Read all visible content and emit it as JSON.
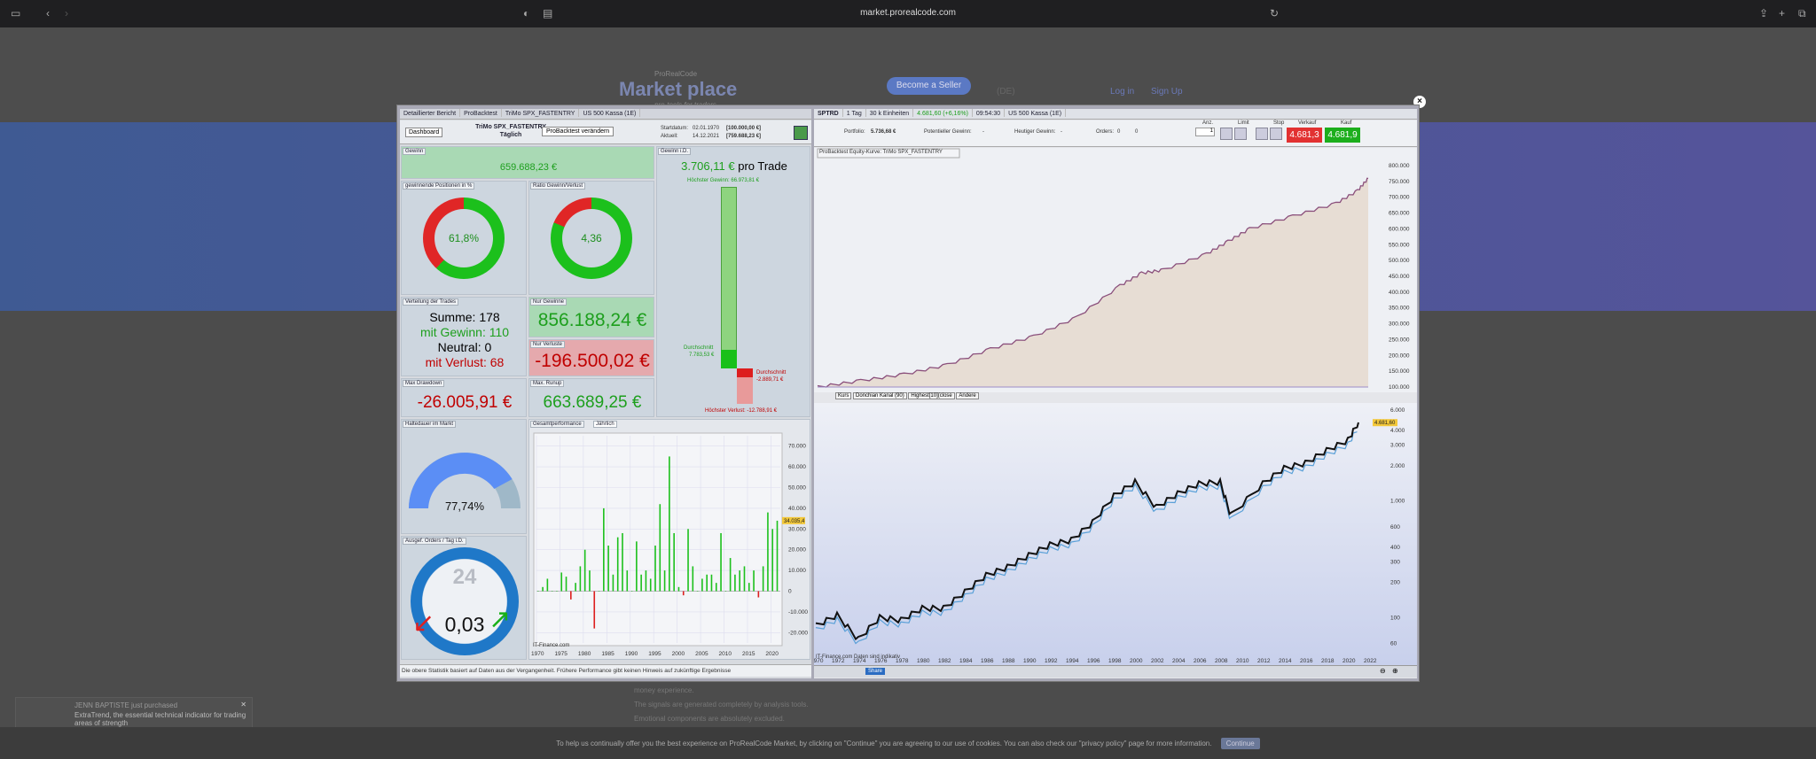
{
  "browser": {
    "url": "market.prorealcode.com"
  },
  "site": {
    "logo_top": "ProRealCode",
    "logo": "Market place",
    "logo_tag": "pro-tools for traders",
    "become_seller": "Become a Seller",
    "currency": "(DE)",
    "badge1": "0",
    "badge2": "0",
    "badge3": "0",
    "login": "Log in",
    "signup": "Sign Up",
    "toast_title": "JENN BAPTISTE just purchased",
    "toast_text": "ExtraTrend, the essential technical indicator for trading areas of strength",
    "lines": [
      "money experience.",
      "The signals are generated completely by analysis tools.",
      "Emotional components are absolutely excluded."
    ],
    "cookie_text": "To help us continually offer you the best experience on ProRealCode Market, by clicking on \"Continue\" you are agreeing to our use of cookies. You can also check our \"privacy policy\" page for more information.",
    "cookie_btn": "Continue"
  },
  "left": {
    "tabs": [
      "Detaillierter Bericht",
      "ProBacktest",
      "TriMo SPX_FASTENTRY",
      "US 500 Kassa (1E)"
    ],
    "dashboard": "Dashboard",
    "title1": "TriMo SPX_FASTENTRY",
    "title2": "Täglich",
    "change_btn": "ProBacktest verändern",
    "start_label": "Startdatum:",
    "start_date": "02.01.1970",
    "start_val": "[100.000,00 €]",
    "now_label": "Aktuell:",
    "now_date": "14.12.2021",
    "now_val": "[759.688,23 €]",
    "gewinn_lbl": "Gewinn",
    "gewinn": "659.688,23 €",
    "win_lbl": "gewinnende Positionen in %",
    "win_pct": "61,8%",
    "win_frac": 0.618,
    "ratio_lbl": "Ratio Gewinn/Verlust",
    "ratio": "4,36",
    "ratio_frac": 0.813,
    "vert_lbl": "Verteilung der Trades",
    "summe": "Summe: 178",
    "mitgewinn": "mit Gewinn: 110",
    "neutral": "Neutral: 0",
    "mitverlust": "mit Verlust: 68",
    "nurgew_lbl": "Nur Gewinne",
    "nurgew": "856.188,24 €",
    "nurverl_lbl": "Nur Verluste",
    "nurverl": "-196.500,02 €",
    "dd_lbl": "Max Drawdown",
    "dd": "-26.005,91 €",
    "ru_lbl": "Max. Runup",
    "ru": "663.689,25 €",
    "gid_lbl": "Gewinn i.D.",
    "pro_trade": "3.706,11 €",
    "pro_trade_sfx": "pro Trade",
    "hg": "Höchster Gewinn: 66.973,81 €",
    "dsg": "Durchschnitt",
    "dsg_v": "7.783,53 €",
    "dsl": "Durchschnitt",
    "dsl_v": "-2.889,71 €",
    "hv": "Höchster Verlust: -12.788,91 €",
    "halte_lbl": "Haltedauer im Markt",
    "halte": "77,74%",
    "halte_frac": 0.7774,
    "orders_lbl": "Ausgef. Orders / Tag i.D.",
    "clock": "24",
    "orders": "0,03",
    "perf_lbl": "Gesamtperformance",
    "perf_mode": "Jährlich",
    "source": "IT-Finance.com",
    "footer": "Die obere Statistik basiert auf Daten aus der Vergangenheit. Frühere Performance gibt keinen Hinweis auf zukünftige Ergebnisse"
  },
  "chart_data": [
    {
      "type": "bar",
      "title": "Gesamtperformance",
      "x": [
        1970,
        1971,
        1972,
        1973,
        1974,
        1975,
        1976,
        1977,
        1978,
        1979,
        1980,
        1981,
        1982,
        1983,
        1984,
        1985,
        1986,
        1987,
        1988,
        1989,
        1990,
        1991,
        1992,
        1993,
        1994,
        1995,
        1996,
        1997,
        1998,
        1999,
        2000,
        2001,
        2002,
        2003,
        2004,
        2005,
        2006,
        2007,
        2008,
        2009,
        2010,
        2011,
        2012,
        2013,
        2014,
        2015,
        2016,
        2017,
        2018,
        2019,
        2020,
        2021
      ],
      "values": [
        0,
        2000,
        6000,
        0,
        0,
        9000,
        7000,
        -4000,
        4000,
        12000,
        20000,
        10000,
        -18000,
        0,
        40000,
        22000,
        8000,
        26000,
        28000,
        10000,
        0,
        24000,
        8000,
        10000,
        6000,
        22000,
        42000,
        10000,
        65000,
        28000,
        2000,
        -2000,
        30000,
        12000,
        0,
        6000,
        8000,
        8000,
        4000,
        28000,
        0,
        16000,
        8000,
        10000,
        12000,
        4000,
        10000,
        -3000,
        12000,
        38000,
        30000,
        34000
      ],
      "ylim": [
        -25000,
        75000
      ],
      "y_ticks": [
        "70.000",
        "60.000",
        "50.000",
        "40.000",
        "30.000",
        "20.000",
        "10.000",
        "0",
        "-10.000",
        "-20.000"
      ],
      "y_values": [
        70000,
        60000,
        50000,
        40000,
        30000,
        20000,
        10000,
        0,
        -10000,
        -20000
      ],
      "marker": "34.035,4",
      "x_ticks": [
        "1970",
        "1975",
        "1980",
        "1985",
        "1990",
        "1995",
        "2000",
        "2005",
        "2010",
        "2015",
        "2020"
      ]
    },
    {
      "type": "area",
      "title": "ProBacktest Equity-Kurve: TriMo SPX_FASTENTRY",
      "x": [
        1970,
        1974,
        1978,
        1982,
        1986,
        1990,
        1994,
        1998,
        2000,
        2002,
        2006,
        2008,
        2010,
        2014,
        2018,
        2020,
        2021
      ],
      "values": [
        100000,
        120000,
        140000,
        170000,
        220000,
        260000,
        320000,
        420000,
        460000,
        470000,
        520000,
        560000,
        600000,
        640000,
        680000,
        720000,
        759688
      ],
      "ylim": [
        100000,
        800000
      ],
      "y_ticks": [
        "800.000",
        "750.000",
        "700.000",
        "650.000",
        "600.000",
        "550.000",
        "500.000",
        "450.000",
        "400.000",
        "350.000",
        "300.000",
        "250.000",
        "200.000",
        "150.000",
        "100.000"
      ],
      "y_values": [
        800000,
        750000,
        700000,
        650000,
        600000,
        550000,
        500000,
        450000,
        400000,
        350000,
        300000,
        250000,
        200000,
        150000,
        100000
      ]
    },
    {
      "type": "line",
      "scale": "log",
      "title": "SPTRD",
      "x": [
        1970,
        1972,
        1974,
        1976,
        1978,
        1980,
        1982,
        1984,
        1986,
        1988,
        1990,
        1992,
        1994,
        1996,
        1998,
        2000,
        2002,
        2004,
        2006,
        2008,
        2009,
        2012,
        2014,
        2016,
        2018,
        2020,
        2021
      ],
      "values": [
        85,
        105,
        65,
        100,
        95,
        120,
        120,
        165,
        230,
        270,
        340,
        420,
        460,
        650,
        1100,
        1450,
        880,
        1150,
        1400,
        1450,
        750,
        1400,
        1900,
        2100,
        2700,
        3300,
        4700
      ],
      "ylim": [
        50,
        6000
      ],
      "y_ticks": [
        "6.000",
        "4.000",
        "3.000",
        "2.000",
        "1.000",
        "600",
        "400",
        "300",
        "200",
        "100",
        "60"
      ],
      "y_values": [
        6000,
        4000,
        3000,
        2000,
        1000,
        600,
        400,
        300,
        200,
        100,
        60
      ],
      "marker": "4.681,60",
      "x_ticks": [
        "1970",
        "1972",
        "1974",
        "1976",
        "1978",
        "1980",
        "1982",
        "1984",
        "1986",
        "1988",
        "1990",
        "1992",
        "1994",
        "1996",
        "1998",
        "2000",
        "2002",
        "2004",
        "2006",
        "2008",
        "2010",
        "2012",
        "2014",
        "2016",
        "2018",
        "2020",
        "2022"
      ]
    }
  ],
  "right": {
    "tabs": [
      "SPTRD",
      "1 Tag",
      "30 k Einheiten",
      "4.681,60 (+6,16%)",
      "09:54:30",
      "US 500 Kassa (1E)"
    ],
    "portfolio_lbl": "Portfolio:",
    "portfolio": "5.736,68 €",
    "pot_lbl": "Potentieller Gewinn:",
    "pot": "-",
    "heut_lbl": "Heutiger Gewinn:",
    "heut": "-",
    "orders_lbl": "Orders:",
    "orders": "0",
    "orders2": "0",
    "anz": "Anz.",
    "limit": "Limit",
    "stop": "Stop",
    "verkauf": "Verkauf",
    "kauf": "Kauf",
    "sell": "4.681,3",
    "buy": "4.681,9",
    "qty": "1",
    "lower_tabs": [
      "Kurs",
      "Donchian Kanal (90)",
      "Highest[10](close",
      "Andere"
    ],
    "source": "IT-Finance.com Daten sind indikativ",
    "share": "Share"
  },
  "colors": {
    "green": "#1d9f1d",
    "red": "#c00000",
    "equity": "#8a4f7b",
    "price": "#111111"
  }
}
